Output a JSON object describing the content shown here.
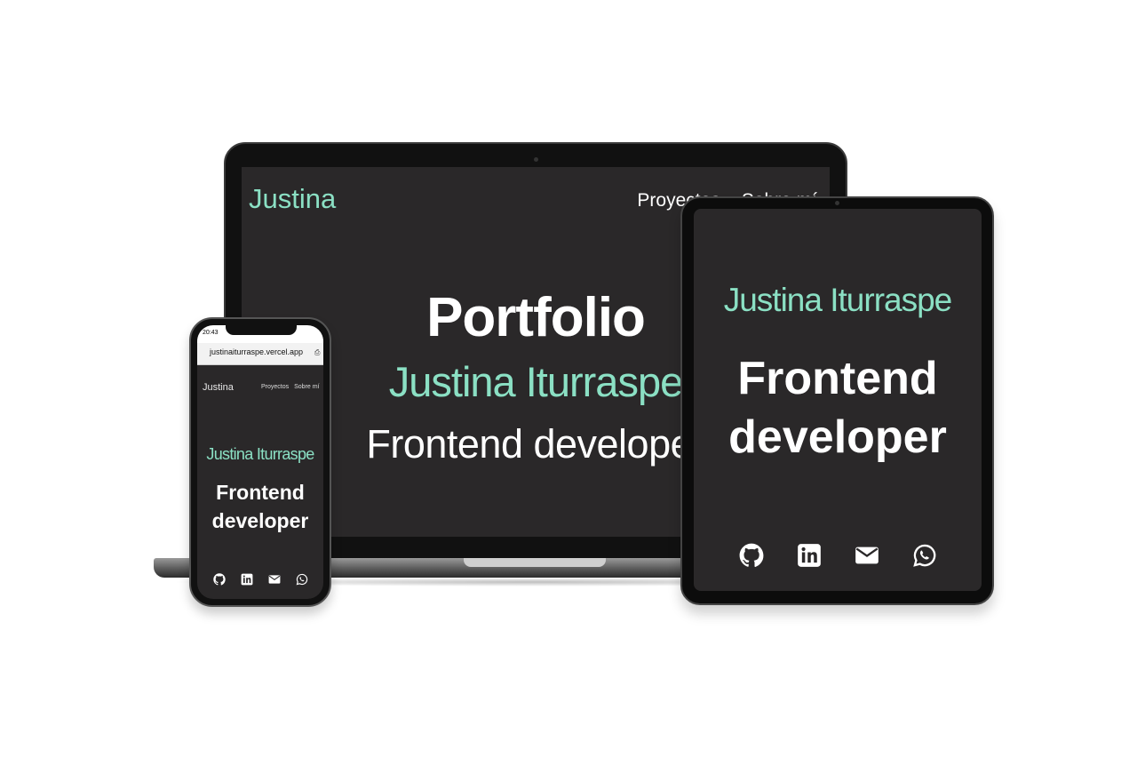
{
  "laptop": {
    "logo": "Justina",
    "nav": [
      "Proyectos",
      "Sobre mí"
    ],
    "title": "Portfolio",
    "name": "Justina Iturraspe",
    "role": "Frontend developer"
  },
  "tablet": {
    "name": "Justina Iturraspe",
    "role_line1": "Frontend",
    "role_line2": "developer",
    "icons": [
      "github-icon",
      "linkedin-icon",
      "mail-icon",
      "whatsapp-icon"
    ]
  },
  "phone": {
    "time": "20:43",
    "url": "justinaiturraspe.vercel.app",
    "logo": "Justina",
    "nav": [
      "Proyectos",
      "Sobre mí"
    ],
    "name": "Justina Iturraspe",
    "role_line1": "Frontend",
    "role_line2": "developer",
    "icons": [
      "github-icon",
      "linkedin-icon",
      "mail-icon",
      "whatsapp-icon"
    ]
  },
  "colors": {
    "accent": "#8be0c4",
    "screen_bg": "#2a2829",
    "text": "#ffffff"
  }
}
